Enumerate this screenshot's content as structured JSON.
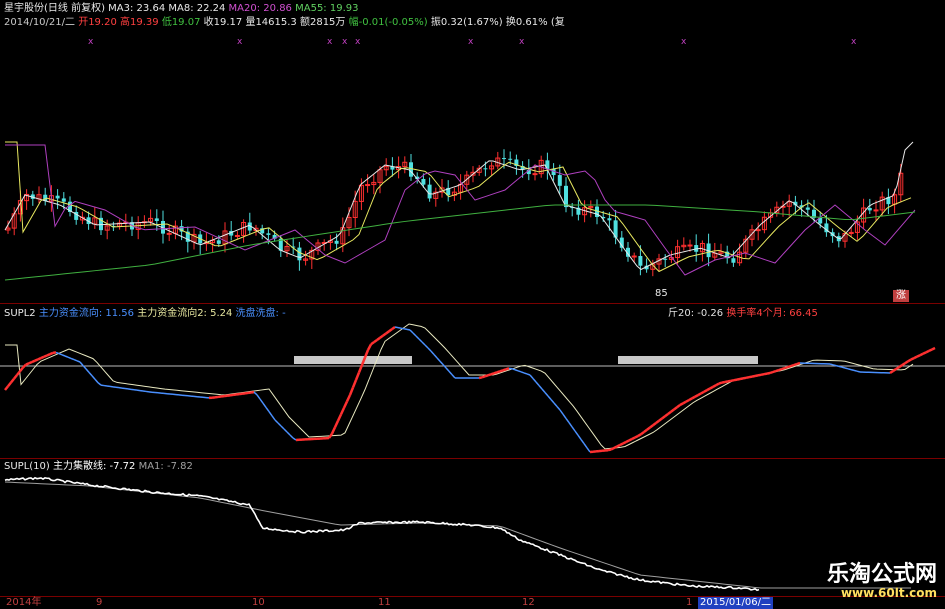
{
  "header": {
    "stock_name": "星宇股份(日线 前复权)",
    "ma_labels": [
      {
        "text": "MA3: 23.64",
        "color": "#e8e8e8"
      },
      {
        "text": "MA8: 22.24",
        "color": "#e8e8e8"
      },
      {
        "text": "MA20: 20.86",
        "color": "#d050d0"
      },
      {
        "text": "MA55: 19.93",
        "color": "#60d060"
      }
    ],
    "quote_line": [
      {
        "text": "2014/10/21/二",
        "color": "#c8c8c8"
      },
      {
        "text": "开19.20",
        "color": "#ff4040"
      },
      {
        "text": "高19.39",
        "color": "#ff4040"
      },
      {
        "text": "低19.07",
        "color": "#40c040"
      },
      {
        "text": "收19.17",
        "color": "#e8e8e8"
      },
      {
        "text": "量14615.3",
        "color": "#e8e8e8"
      },
      {
        "text": "额2815万",
        "color": "#e8e8e8"
      },
      {
        "text": "幅-0.01(-0.05%)",
        "color": "#40c040"
      },
      {
        "text": "振0.32(1.67%)",
        "color": "#e8e8e8"
      },
      {
        "text": "换0.61%",
        "color": "#e8e8e8"
      },
      {
        "text": "(复",
        "color": "#e8e8e8"
      }
    ]
  },
  "price_panel": {
    "low_marker": "85",
    "corner_badge": "涨"
  },
  "supl2_panel": {
    "title": "SUPL2",
    "labels": [
      {
        "text": "主力资金流向: 11.56",
        "color": "#4a90ff"
      },
      {
        "text": "主力资金流向2: 5.24",
        "color": "#e8e8a0"
      },
      {
        "text": "洗盘洗盘: -",
        "color": "#4a90ff"
      }
    ],
    "right_labels": [
      {
        "text": "斤20: -0.26",
        "color": "#e0e0e0"
      },
      {
        "text": "换手率4个月: 66.45",
        "color": "#ff4040"
      }
    ]
  },
  "supl_panel": {
    "title": "SUPL(10)",
    "labels": [
      {
        "text": "主力集散线: -7.72",
        "color": "#ffffff"
      },
      {
        "text": "MA1: -7.82",
        "color": "#a0a0a0"
      }
    ]
  },
  "x_axis": {
    "labels": [
      "2014年",
      "9",
      "10",
      "11",
      "12",
      "1",
      "2015/01/06/二"
    ]
  },
  "watermark": {
    "title": "乐淘公式网",
    "url": "www.60lt.com"
  },
  "colors": {
    "up": "#ff3030",
    "down": "#50e0e0",
    "ma3": "#e8e8e8",
    "ma8": "#e8e860",
    "ma20": "#c040c0",
    "ma55": "#40b040",
    "grid": "#7a0000"
  }
}
